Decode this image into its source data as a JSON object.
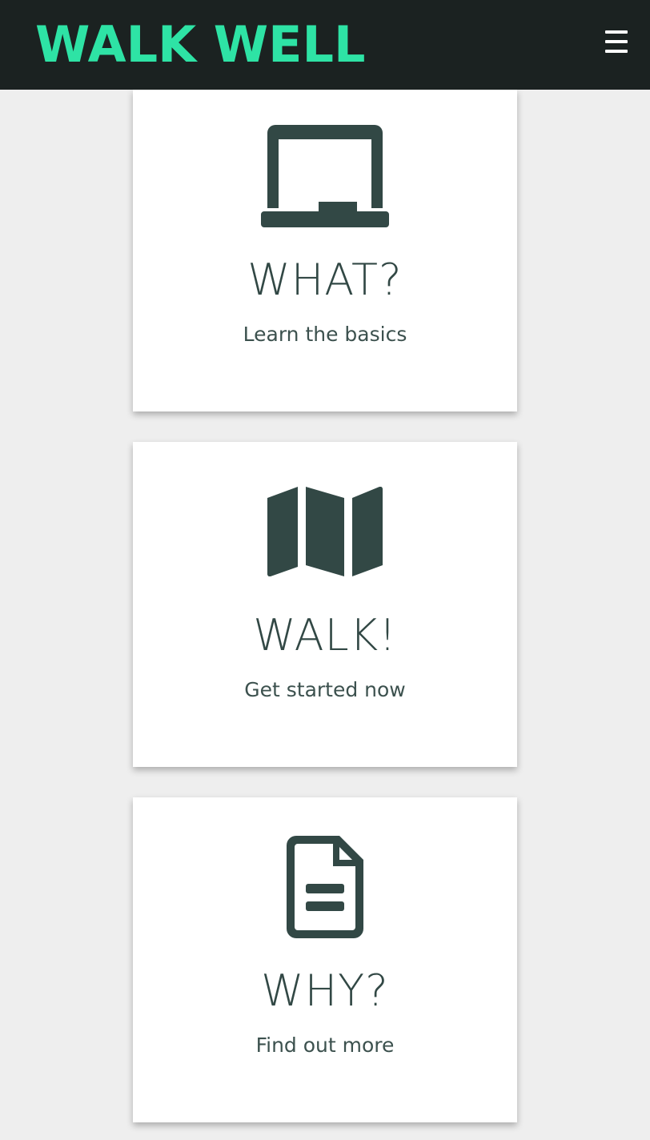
{
  "header": {
    "brand": "WALK WELL",
    "menu_icon": "hamburger-menu-icon",
    "background": "#1b2221",
    "brand_color": "#2ee3a5"
  },
  "cards": [
    {
      "icon": "laptop-icon",
      "title": "WHAT?",
      "subtitle": "Learn the basics"
    },
    {
      "icon": "map-icon",
      "title": "WALK!",
      "subtitle": "Get started now"
    },
    {
      "icon": "document-icon",
      "title": "WHY?",
      "subtitle": "Find out more"
    }
  ],
  "colors": {
    "page_background": "#eeeeee",
    "card_background": "#ffffff",
    "icon_and_text": "#324845"
  }
}
